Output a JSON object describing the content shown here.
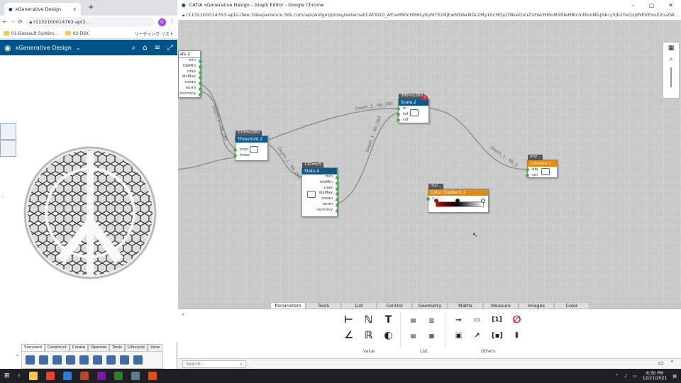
{
  "left_browser": {
    "tab_title": "xGenerative Design",
    "new_tab_glyph": "+",
    "url": "r1132100014763-apt2...",
    "profile_initial": "G",
    "bookmarks": [
      "01-Dassault Systèm...",
      "02-DSK",
      "リーディング リスト"
    ],
    "app_title": "xGenerative Design",
    "toolbar_tabs": [
      "Standard",
      "Construct",
      "Create",
      "Operate",
      "Tools",
      "Lifecycle",
      "View"
    ]
  },
  "right_window": {
    "title": "CATIA xGenerative Design - Graph Editor - Google Chrome",
    "url": "r1132100014763-apt2-ifwe.3dexperience.3ds.com/api/widget/proxy/external/CATXGD_AP/aHR0cHM6Ly9yMTEzMjEwMDAxNDc2My1hcHQyLTNkeGVuZ2FwcHMuM2RleHBlcmllbmNlLjNkcy5jb20vQzJzNEVEVuZ2IuZW..."
  },
  "nodes": {
    "stats2": {
      "title": "ats.2",
      "ports": [
        "min",
        "idxMin",
        "max",
        "idxMax",
        "mean",
        "norm",
        "norminv"
      ]
    },
    "threshold2": {
      "time": "110ms/260",
      "title": "Threshold.2",
      "inputs": [
        "tmin",
        "tmax"
      ]
    },
    "stats4": {
      "time": "110ms/5",
      "title": "Stats.4",
      "ports": [
        "min",
        "idxMin",
        "max",
        "idxMax",
        "mean",
        "norm",
        "norminv"
      ]
    },
    "scale2": {
      "time": "380ms/260",
      "title": "Scale.2",
      "inputs": [
        "in",
        "ref",
        "rat"
      ]
    },
    "colorize1": {
      "time": "ms/...",
      "title": "Colorize.1",
      "inputs": [
        "obj",
        "col"
      ]
    },
    "gradient1": {
      "time": "ms/...",
      "title": "Color Gradient.1",
      "inputs": [
        "t"
      ]
    }
  },
  "edge_labels": {
    "e1": "Depth_2 , Nb_260",
    "e2": "Depth_1 , Nb_260",
    "e3": "Depth_1 , Nb_260",
    "e4": "Depth_1 , Nb_260",
    "e5": "Depth_1 , Nb_5"
  },
  "panel": {
    "tabs": [
      "Parameters",
      "Tools",
      "List",
      "Control",
      "Geometry",
      "Maths",
      "Measure",
      "Images",
      "Color"
    ],
    "groups": [
      "Value",
      "List",
      "Others"
    ],
    "search_placeholder": "Search..."
  },
  "taskbar": {
    "time": "6:30 PM",
    "date": "12/21/2021"
  }
}
